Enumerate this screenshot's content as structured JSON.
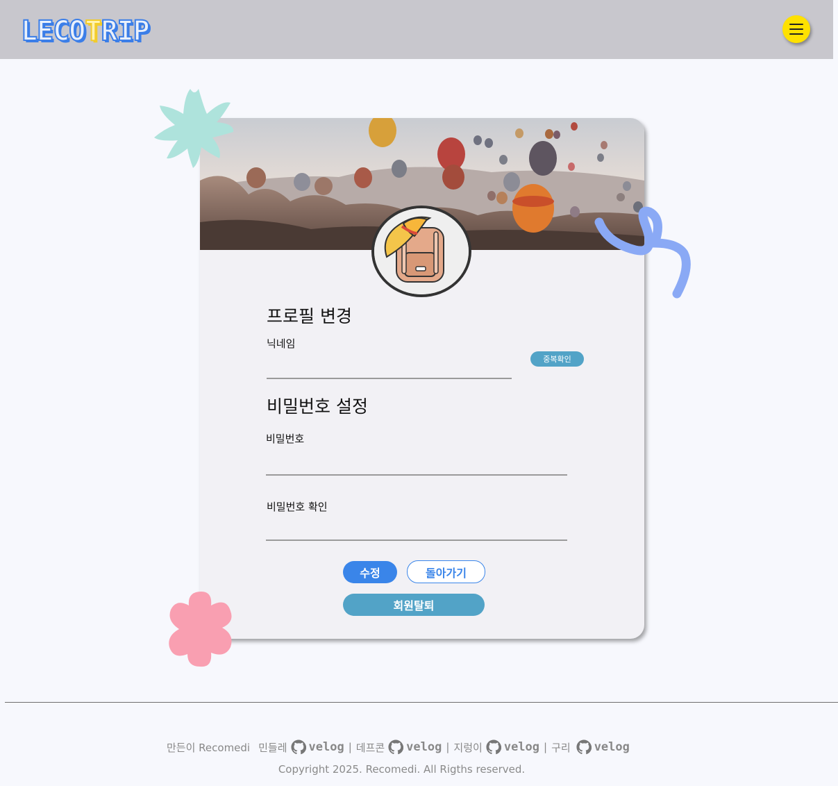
{
  "header": {
    "logo_letters": [
      "L",
      "E",
      "C",
      "O",
      "T",
      "R",
      "I",
      "P"
    ],
    "menu_icon": "hamburger-icon"
  },
  "profile": {
    "title": "프로필 변경",
    "nickname_label": "닉네임",
    "nickname_value": "",
    "dup_check_label": "중복확인"
  },
  "password": {
    "title": "비밀번호 설정",
    "password_label": "비밀번호",
    "password_value": "",
    "confirm_label": "비밀번호 확인",
    "confirm_value": ""
  },
  "actions": {
    "edit_label": "수정",
    "back_label": "돌아가기",
    "withdraw_label": "회원탈퇴"
  },
  "footer": {
    "made_by": "만든이 Recomedi",
    "members": [
      {
        "name": "민들레",
        "link": "velog",
        "sep": "|"
      },
      {
        "name": "데프콘",
        "link": "velog",
        "sep": "|"
      },
      {
        "name": "지렁이",
        "link": "velog",
        "sep": "|"
      },
      {
        "name": "구리",
        "link": "velog",
        "sep": ""
      }
    ],
    "copyright": "Copyright 2025. Recomedi. All Rigths reserved."
  },
  "colors": {
    "header_bg": "#c8c7cd",
    "accent_blue": "#3a85e9",
    "teal": "#52a3c7",
    "menu_yellow": "#ffe100",
    "flower_pink": "#f99fb1",
    "star_mint": "#aee3dc",
    "squiggle_blue": "#8aa9f5"
  }
}
